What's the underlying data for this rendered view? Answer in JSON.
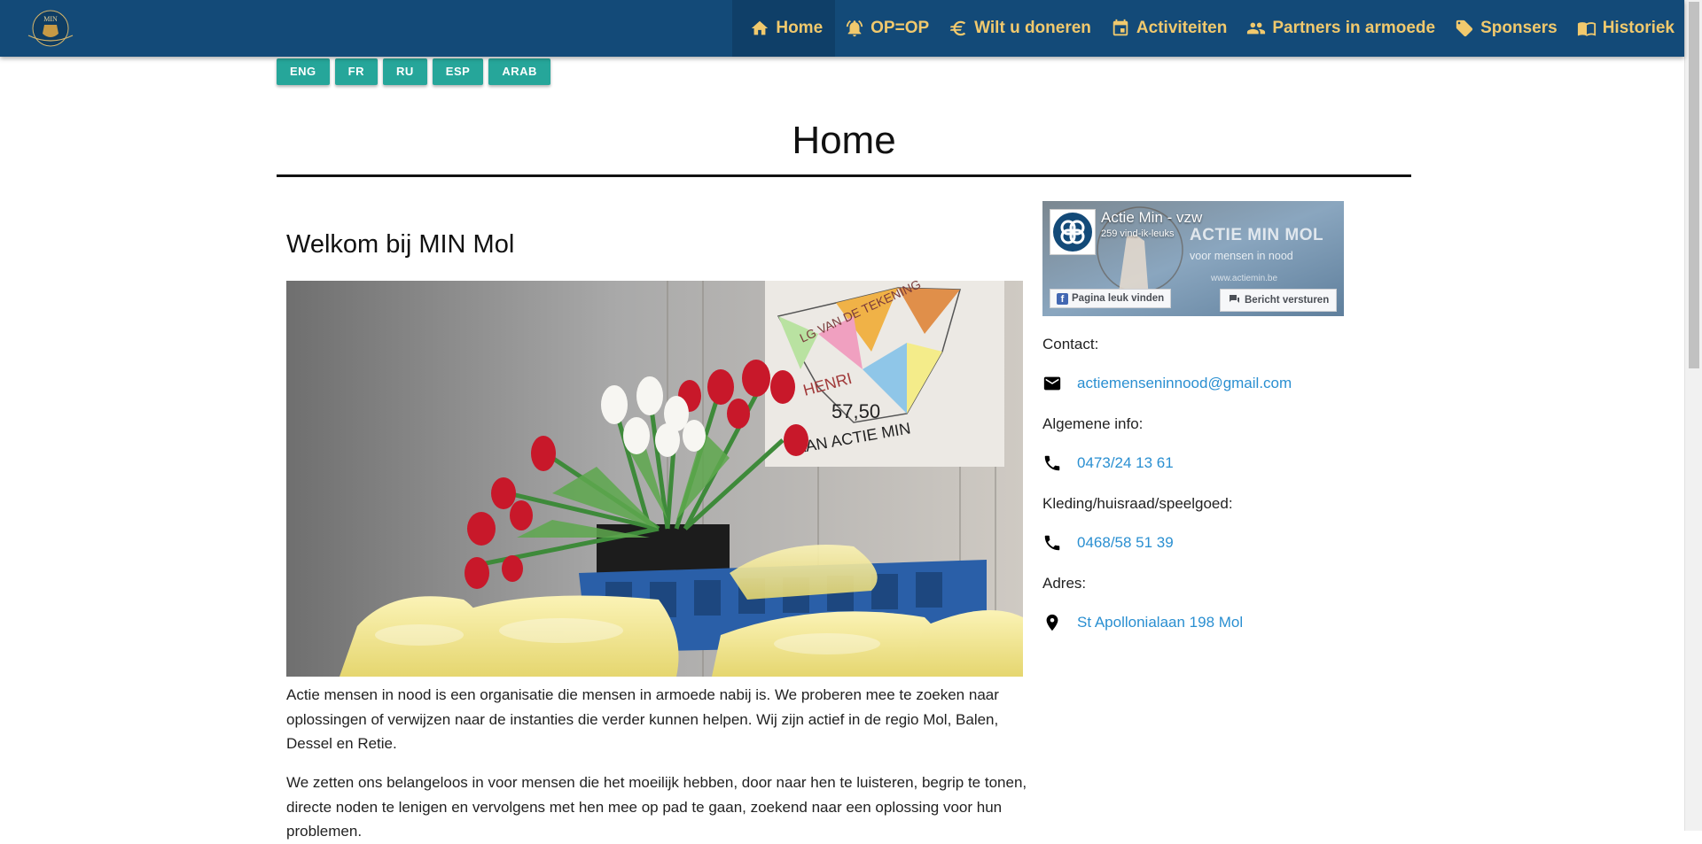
{
  "colors": {
    "navbar": "#134a78",
    "nav_text": "#f1c96d",
    "lang_button": "#26a69a",
    "link": "#2a8fd1"
  },
  "logo": {
    "text": "MIN"
  },
  "nav": {
    "items": [
      {
        "label": "Home",
        "icon": "home-icon",
        "active": true
      },
      {
        "label": "OP=OP",
        "icon": "alarm-bell-icon"
      },
      {
        "label": "Wilt u doneren",
        "icon": "euro-icon"
      },
      {
        "label": "Activiteiten",
        "icon": "calendar-icon"
      },
      {
        "label": "Partners in armoede",
        "icon": "people-icon"
      },
      {
        "label": "Sponsers",
        "icon": "tag-icon"
      },
      {
        "label": "Historiek",
        "icon": "book-icon"
      }
    ]
  },
  "languages": [
    "ENG",
    "FR",
    "RU",
    "ESP",
    "ARAB"
  ],
  "page": {
    "title": "Home",
    "welcome": "Welkom bij MIN Mol",
    "paragraphs": [
      "Actie mensen in nood is een organisatie die mensen in armoede nabij is. We proberen mee te zoeken naar oplossingen of verwijzen naar de instanties die verder kunnen helpen. Wij zijn actief in de regio Mol, Balen, Dessel en Retie.",
      "We zetten ons belangeloos in voor mensen die het moeilijk hebben, door naar hen te luisteren, begrip te tonen, directe noden te lenigen en vervolgens met hen mee op pad te gaan, zoekend naar een oplossing voor hun problemen."
    ]
  },
  "photo": {
    "sign_lines": [
      "LG VAN DE TEKENING",
      "HENRI",
      "57,50",
      "AAN ACTIE MIN"
    ]
  },
  "facebook": {
    "name": "Actie Min - vzw",
    "likes": "259 vind-ik-leuks",
    "like_button": "Pagina leuk vinden",
    "message_button": "Bericht versturen",
    "brand_title": "ACTIE MIN MOL",
    "brand_subtitle": "voor mensen in nood",
    "brand_url": "www.actiemin.be"
  },
  "contact": {
    "contact_label": "Contact:",
    "email": "actiemenseninnood@gmail.com",
    "general_label": "Algemene info:",
    "general_phone": "0473/24 13 61",
    "clothing_label": "Kleding/huisraad/speelgoed:",
    "clothing_phone": "0468/58 51 39",
    "address_label": "Adres:",
    "address": "St Apollonialaan 198 Mol"
  }
}
